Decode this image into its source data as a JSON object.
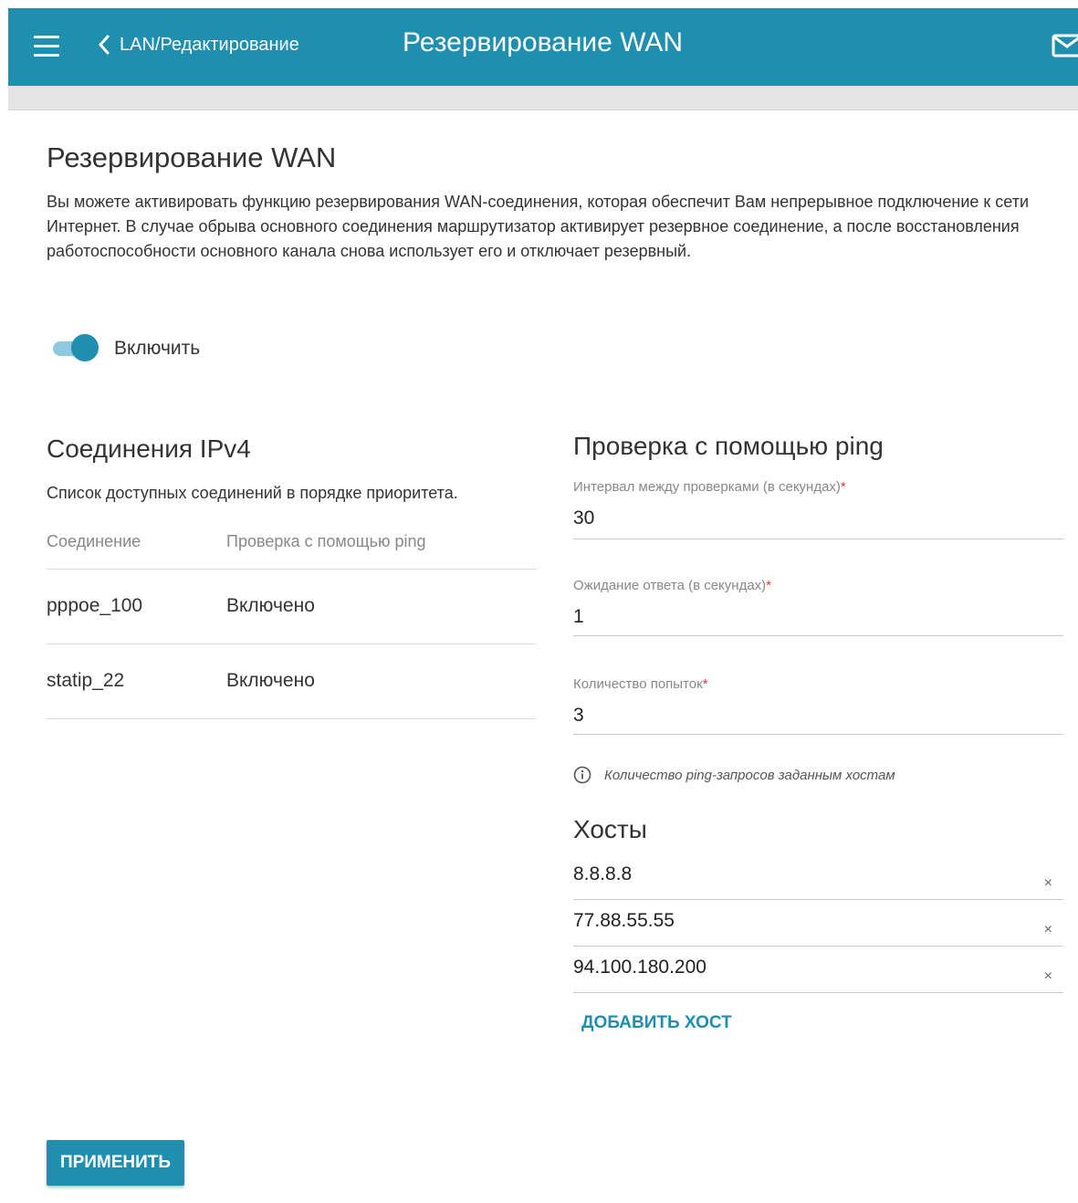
{
  "topbar": {
    "back_label": "LAN/Редактирование",
    "title": "Резервирование WAN",
    "icons": [
      "menu-icon",
      "chevron-left-icon",
      "mail-icon"
    ],
    "accent_color": "#1f8fb0"
  },
  "main": {
    "title": "Резервирование WAN",
    "description": "Вы можете активировать функцию резервирования WAN-соединения, которая обеспечит Вам непрерывное подключение к сети Интернет. В случае обрыва основного соединения маршрутизатор активирует резервное соединение, а после восстановления работоспособности основного канала снова использует его и отключает резервный.",
    "enable_toggle": {
      "label": "Включить",
      "on": true
    }
  },
  "connections": {
    "title": "Соединения IPv4",
    "description": "Список доступных соединений в порядке приоритета.",
    "columns": [
      "Соединение",
      "Проверка с помощью ping"
    ],
    "rows": [
      [
        "pppoe_100",
        "Включено"
      ],
      [
        "statip_22",
        "Включено"
      ]
    ]
  },
  "ping": {
    "title": "Проверка с помощью ping",
    "interval": {
      "label": "Интервал между проверками (в секундах)",
      "required": "*",
      "value": "30"
    },
    "timeout": {
      "label": "Ожидание ответа (в секундах)",
      "required": "*",
      "value": "1"
    },
    "attempts": {
      "label": "Количество попыток",
      "required": "*",
      "value": "3"
    },
    "hint": "Количество ping-запросов заданным хостам",
    "hosts_title": "Хосты",
    "hosts": [
      "8.8.8.8",
      "77.88.55.55",
      "94.100.180.200"
    ],
    "clear_symbol": "×",
    "add_host_label": "ДОБАВИТЬ ХОСТ"
  },
  "actions": {
    "apply_label": "ПРИМЕНИТЬ"
  }
}
